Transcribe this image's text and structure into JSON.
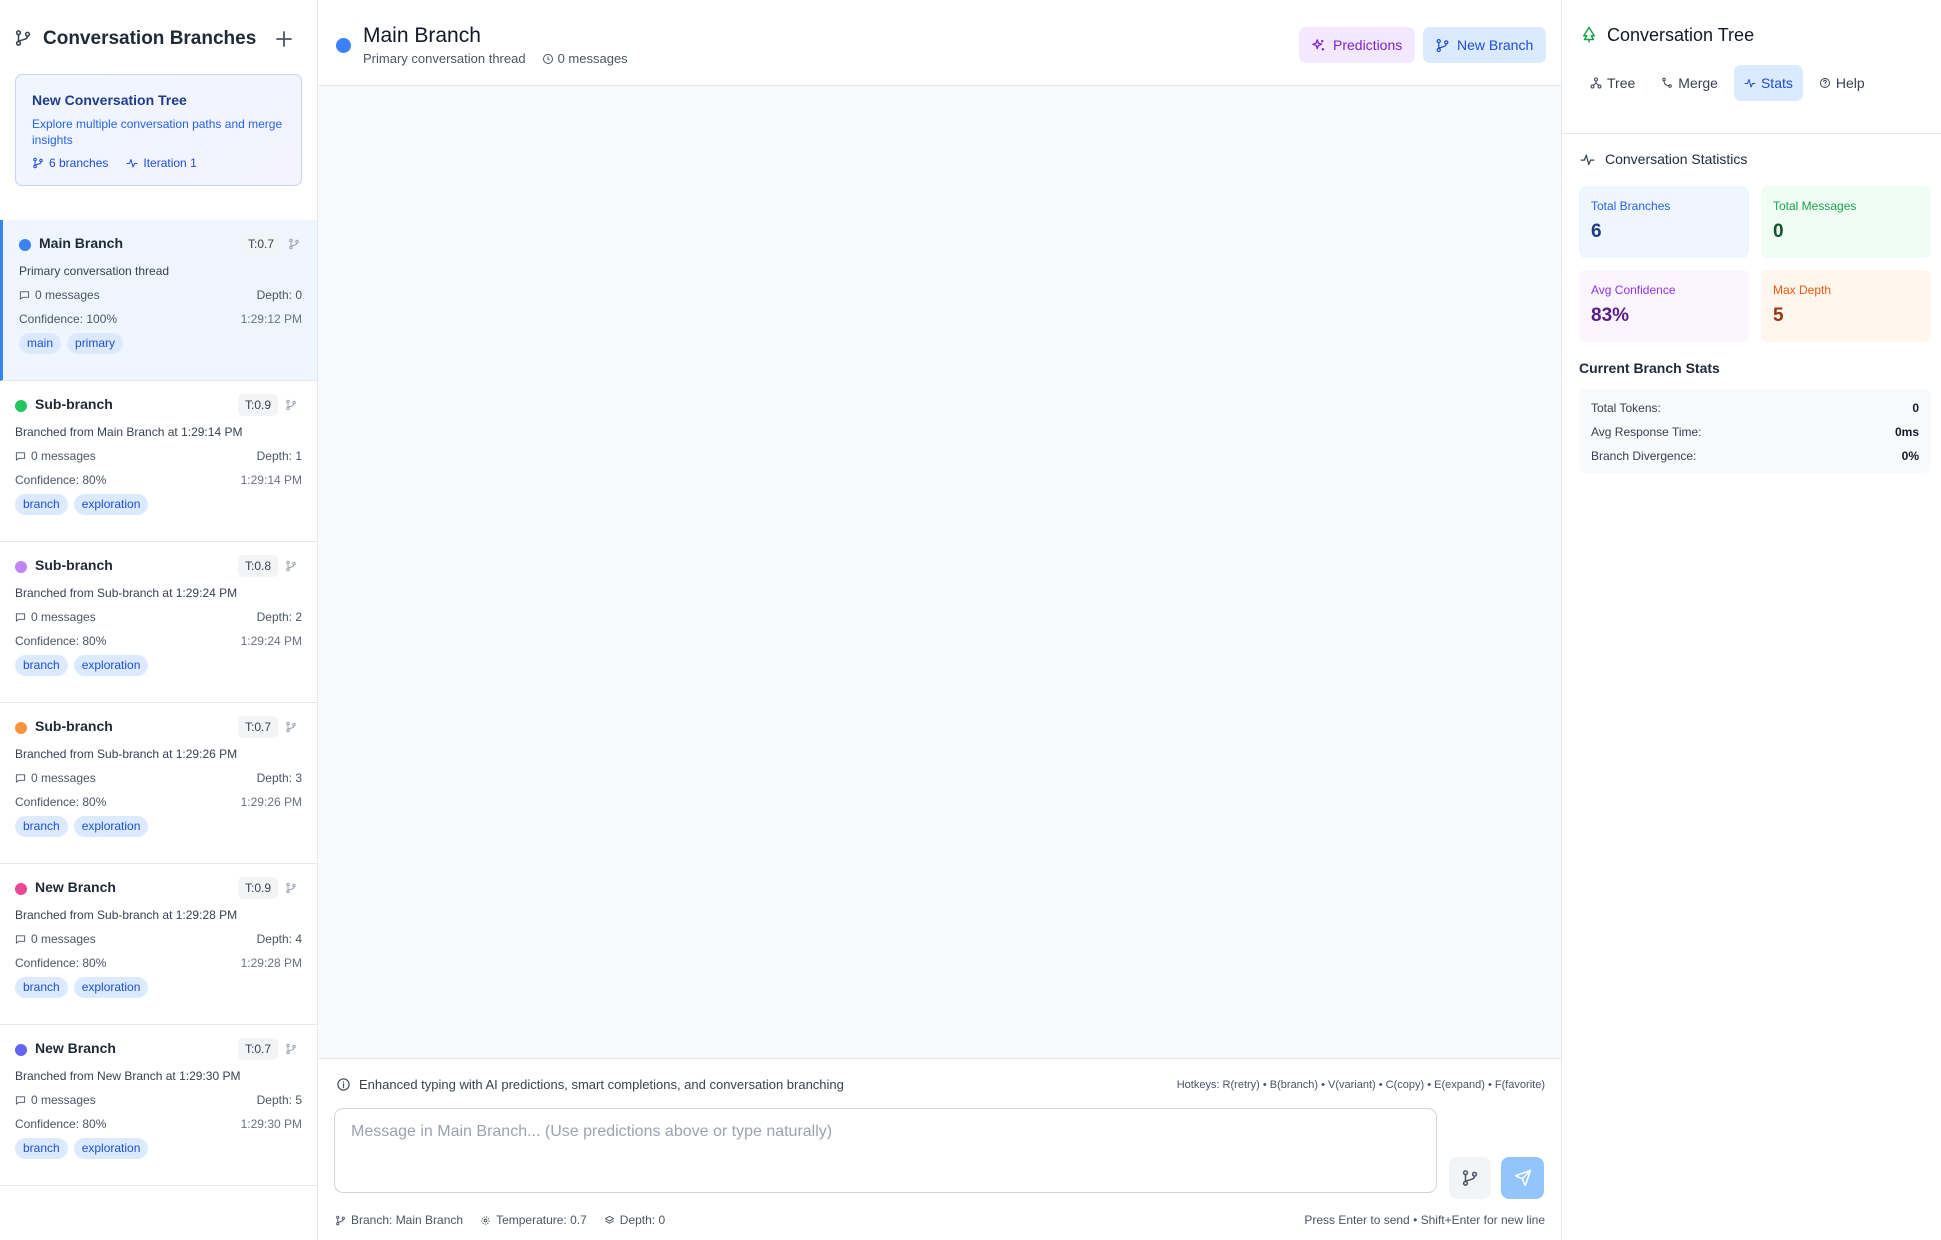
{
  "sidebar": {
    "title": "Conversation Branches",
    "tree_card": {
      "title": "New Conversation Tree",
      "description": "Explore multiple conversation paths and merge insights",
      "branches_count": "6 branches",
      "iteration": "Iteration 1"
    },
    "branches": [
      {
        "name": "Main Branch",
        "temp": "T:0.7",
        "description": "Primary conversation thread",
        "messages": "0 messages",
        "depth": "Depth: 0",
        "confidence": "Confidence: 100%",
        "time": "1:29:12 PM",
        "tags": [
          "main",
          "primary"
        ],
        "color": "#3b82f6"
      },
      {
        "name": "Sub-branch",
        "temp": "T:0.9",
        "description": "Branched from Main Branch at 1:29:14 PM",
        "messages": "0 messages",
        "depth": "Depth: 1",
        "confidence": "Confidence: 80%",
        "time": "1:29:14 PM",
        "tags": [
          "branch",
          "exploration"
        ],
        "color": "#22c55e"
      },
      {
        "name": "Sub-branch",
        "temp": "T:0.8",
        "description": "Branched from Sub-branch at 1:29:24 PM",
        "messages": "0 messages",
        "depth": "Depth: 2",
        "confidence": "Confidence: 80%",
        "time": "1:29:24 PM",
        "tags": [
          "branch",
          "exploration"
        ],
        "color": "#c084fc"
      },
      {
        "name": "Sub-branch",
        "temp": "T:0.7",
        "description": "Branched from Sub-branch at 1:29:26 PM",
        "messages": "0 messages",
        "depth": "Depth: 3",
        "confidence": "Confidence: 80%",
        "time": "1:29:26 PM",
        "tags": [
          "branch",
          "exploration"
        ],
        "color": "#fb923c"
      },
      {
        "name": "New Branch",
        "temp": "T:0.9",
        "description": "Branched from Sub-branch at 1:29:28 PM",
        "messages": "0 messages",
        "depth": "Depth: 4",
        "confidence": "Confidence: 80%",
        "time": "1:29:28 PM",
        "tags": [
          "branch",
          "exploration"
        ],
        "color": "#ec4899"
      },
      {
        "name": "New Branch",
        "temp": "T:0.7",
        "description": "Branched from New Branch at 1:29:30 PM",
        "messages": "0 messages",
        "depth": "Depth: 5",
        "confidence": "Confidence: 80%",
        "time": "1:29:30 PM",
        "tags": [
          "branch",
          "exploration"
        ],
        "color": "#6366f1"
      }
    ]
  },
  "main": {
    "title": "Main Branch",
    "subtitle": "Primary conversation thread",
    "message_count": "0 messages",
    "predictions_label": "Predictions",
    "new_branch_label": "New Branch",
    "composer": {
      "info": "Enhanced typing with AI predictions, smart completions, and conversation branching",
      "hotkeys": "Hotkeys: R(retry) • B(branch) • V(variant) • C(copy) • E(expand) • F(favorite)",
      "placeholder": "Message in Main Branch... (Use predictions above or type naturally)",
      "status_branch": "Branch: Main Branch",
      "status_temperature": "Temperature: 0.7",
      "status_depth": "Depth: 0",
      "hint": "Press Enter to send • Shift+Enter for new line"
    }
  },
  "right_panel": {
    "title": "Conversation Tree",
    "tabs": [
      "Tree",
      "Merge",
      "Stats",
      "Help"
    ],
    "active_tab": "Stats",
    "stats_title": "Conversation Statistics",
    "stats": [
      {
        "label": "Total Branches",
        "value": "6"
      },
      {
        "label": "Total Messages",
        "value": "0"
      },
      {
        "label": "Avg Confidence",
        "value": "83%"
      },
      {
        "label": "Max Depth",
        "value": "5"
      }
    ],
    "current_title": "Current Branch Stats",
    "current": [
      {
        "label": "Total Tokens:",
        "value": "0"
      },
      {
        "label": "Avg Response Time:",
        "value": "0ms"
      },
      {
        "label": "Branch Divergence:",
        "value": "0%"
      }
    ]
  }
}
